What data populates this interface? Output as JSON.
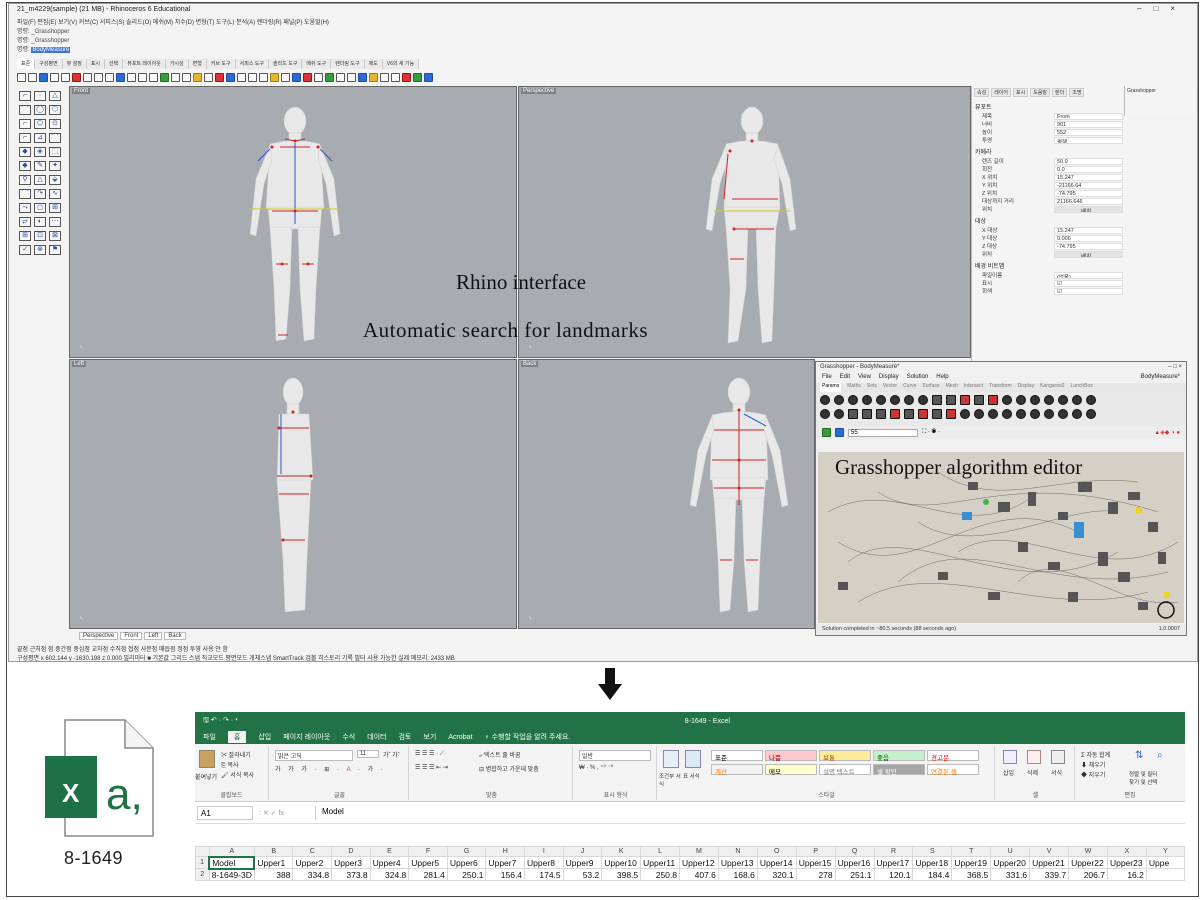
{
  "rhino": {
    "title": "21_m4229(sample) (21 MB) - Rhinoceros 6 Educational",
    "menu": "파일(F)  편집(E)  보기(V)  커브(C)  서피스(S)  솔리드(O)  메쉬(M)  치수(D)  변형(T)  도구(L)  분석(A)  렌더링(R)  패널(P)  도움말(H)",
    "cmd1": "명령: _Grasshopper",
    "cmd2": "명령: _Grasshopper",
    "cmd3_prefix": "명령: ",
    "cmd3_hl": "BodyMeasure",
    "tabs": [
      "표준",
      "구성평면",
      "뷰 설정",
      "표시",
      "선택",
      "뷰포트 레이아웃",
      "가시성",
      "변형",
      "커브 도구",
      "서피스 도구",
      "솔리드 도구",
      "메쉬 도구",
      "렌더링 도구",
      "제도",
      "V6의 새 기능"
    ],
    "viewports": {
      "front": "Front",
      "perspective": "Perspective",
      "left": "Left",
      "back": "Back"
    },
    "bottom_tabs": [
      "Perspective",
      "Front",
      "Left",
      "Back"
    ],
    "osnap": "끝점  근처점  점  중간점  중심점  교차점  수직점  접점  사분점  매듭점  정점  투영  사용 안 함",
    "status": "구성평면   x 602.144   y -1630.198   z 0.000     밀리미터   ■ 기본값        그리드 스냅   직교모드   평면모드   개체스냅   SmartTrack   검볼   히스토리 기록   필터   사용 가능한 실제 메모리: 2433 MB"
  },
  "overlay": {
    "rhino_interface": "Rhino interface",
    "landmarks": "Automatic search for landmarks",
    "gh_editor": "Grasshopper algorithm editor"
  },
  "properties": {
    "tabs": [
      "속성",
      "레이어",
      "표시",
      "도움말",
      "렌더",
      "조명"
    ],
    "gh_tab": "Grasshopper",
    "sections": [
      {
        "title": "뷰포트",
        "rows": [
          [
            "제목",
            "Front"
          ],
          [
            "너비",
            "901"
          ],
          [
            "높이",
            "552"
          ],
          [
            "투영",
            "평행"
          ]
        ]
      },
      {
        "title": "카메라",
        "rows": [
          [
            "렌즈 길이",
            "50.0"
          ],
          [
            "회전",
            "0.0"
          ],
          [
            "X 위치",
            "15.247"
          ],
          [
            "Y 위치",
            "-21166.64"
          ],
          [
            "Z 위치",
            "-74.795"
          ],
          [
            "대상까지 거리",
            "21166.646"
          ],
          [
            "위치",
            "배치..."
          ]
        ]
      },
      {
        "title": "대상",
        "rows": [
          [
            "X 대상",
            "15.247"
          ],
          [
            "Y 대상",
            "0.006"
          ],
          [
            "Z 대상",
            "-74.795"
          ],
          [
            "위치",
            "배치..."
          ]
        ]
      },
      {
        "title": "배경 비트맵",
        "rows": [
          [
            "파일이름",
            "(없음)"
          ],
          [
            "표시",
            "☑"
          ],
          [
            "회색",
            "☑"
          ]
        ]
      }
    ]
  },
  "grasshopper": {
    "title": "Grasshopper - BodyMeasure*",
    "menu": [
      "File",
      "Edit",
      "View",
      "Display",
      "Solution",
      "Help"
    ],
    "doc": "BodyMeasure*",
    "comp_tabs": [
      "Params",
      "Maths",
      "Sets",
      "Vector",
      "Curve",
      "Surface",
      "Mesh",
      "Intersect",
      "Transform",
      "Display",
      "Kangaroo2",
      "LunchBox"
    ],
    "zoom": "55",
    "status": "Solution completed in ~80.5 seconds (88 seconds ago)",
    "version": "1.0.0007"
  },
  "file": {
    "name": "8-1649",
    "x_letter": "X",
    "a_letter": "a,"
  },
  "excel": {
    "title": "8-1649 - Excel",
    "tabs": [
      "파일",
      "홈",
      "삽입",
      "페이지 레이아웃",
      "수식",
      "데이터",
      "검토",
      "보기",
      "Acrobat",
      "♀ 수행할 작업을 알려 주세요."
    ],
    "clip_label": "클립보드",
    "font_label": "글꼴",
    "align_label": "맞춤",
    "num_label": "표시 형식",
    "style_label": "스타일",
    "cell_label": "셀",
    "edit_label": "편집",
    "paste": "붙여넣기",
    "cut": "잘라내기",
    "copy": "복사",
    "fmt": "서식 복사",
    "font": "맑은 고딕",
    "size": "11",
    "wrap": "텍스트 줄 바꿈",
    "merge": "병합하고 가운데 맞춤",
    "numfmt": "일반",
    "cond": "조건부 서식",
    "tbl": "표 서식",
    "insert": "삽입",
    "delete": "삭제",
    "format": "서식",
    "autosum": "자동 합계",
    "fill": "채우기",
    "clear": "지우기",
    "sort": "정렬 및 필터",
    "find": "찾기 및 선택",
    "styles": [
      {
        "label": "표준",
        "bg": "#ffffff",
        "fg": "#000000"
      },
      {
        "label": "나쁨",
        "bg": "#ffc7ce",
        "fg": "#9c0006"
      },
      {
        "label": "보통",
        "bg": "#ffeb9c",
        "fg": "#9c5700"
      },
      {
        "label": "좋음",
        "bg": "#c6efce",
        "fg": "#006100"
      },
      {
        "label": "경고문",
        "bg": "#ffffff",
        "fg": "#ff0000"
      },
      {
        "label": "계산",
        "bg": "#f2f2f2",
        "fg": "#fa7d00"
      },
      {
        "label": "메모",
        "bg": "#ffffcc",
        "fg": "#000000"
      },
      {
        "label": "설명 텍스트",
        "bg": "#ffffff",
        "fg": "#7f7f7f"
      },
      {
        "label": "셀 확인",
        "bg": "#a5a5a5",
        "fg": "#ffffff"
      },
      {
        "label": "연결된 셀",
        "bg": "#ffffff",
        "fg": "#fa7d00"
      }
    ],
    "namebox": "A1",
    "formula": "Model",
    "columns": [
      "A",
      "B",
      "C",
      "D",
      "E",
      "F",
      "G",
      "H",
      "I",
      "J",
      "K",
      "L",
      "M",
      "N",
      "O",
      "P",
      "Q",
      "R",
      "S",
      "T",
      "U",
      "V",
      "W",
      "X",
      "Y"
    ],
    "row1": [
      "Model",
      "Upper1",
      "Upper2",
      "Upper3",
      "Upper4",
      "Upper5",
      "Upper6",
      "Upper7",
      "Upper8",
      "Upper9",
      "Upper10",
      "Upper11",
      "Upper12",
      "Upper13",
      "Upper14",
      "Upper15",
      "Upper16",
      "Upper17",
      "Upper18",
      "Upper19",
      "Upper20",
      "Upper21",
      "Upper22",
      "Upper23",
      "Uppe"
    ],
    "row2": [
      "8-1649-3D",
      "388",
      "334.8",
      "373.8",
      "324.8",
      "281.4",
      "250.1",
      "156.4",
      "174.5",
      "53.2",
      "398.5",
      "250.8",
      "407.6",
      "168.6",
      "320.1",
      "278",
      "251.1",
      "120.1",
      "184.4",
      "368.5",
      "331.6",
      "339.7",
      "206.7",
      "16.2",
      ""
    ]
  },
  "colors": {
    "excel_green": "#217346",
    "viewport_bg": "#a8abb0",
    "gh_canvas": "#d4d0c6"
  }
}
